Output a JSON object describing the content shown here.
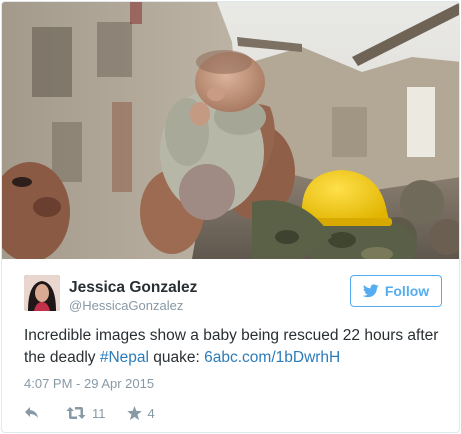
{
  "tweet": {
    "author": {
      "display_name": "Jessica Gonzalez",
      "handle": "@HessicaGonzalez"
    },
    "follow_label": "Follow",
    "text": {
      "before_hashtag": "Incredible images show a baby being rescued 22 hours after the deadly ",
      "hashtag": "#Nepal",
      "after_hashtag": " quake: ",
      "link": "6abc.com/1bDwrhH"
    },
    "timestamp": "4:07 PM - 29 Apr 2015",
    "retweet_count": "11",
    "favorite_count": "4"
  },
  "icons": {
    "follow": "twitter-bird-icon",
    "reply": "reply-arrow-icon",
    "retweet": "retweet-icon",
    "favorite": "star-icon"
  },
  "colors": {
    "accent_blue": "#55acee",
    "link_blue": "#2b7bb9",
    "muted_gray": "#8899a6",
    "text_dark": "#292f33",
    "border": "#e1e8ed"
  }
}
